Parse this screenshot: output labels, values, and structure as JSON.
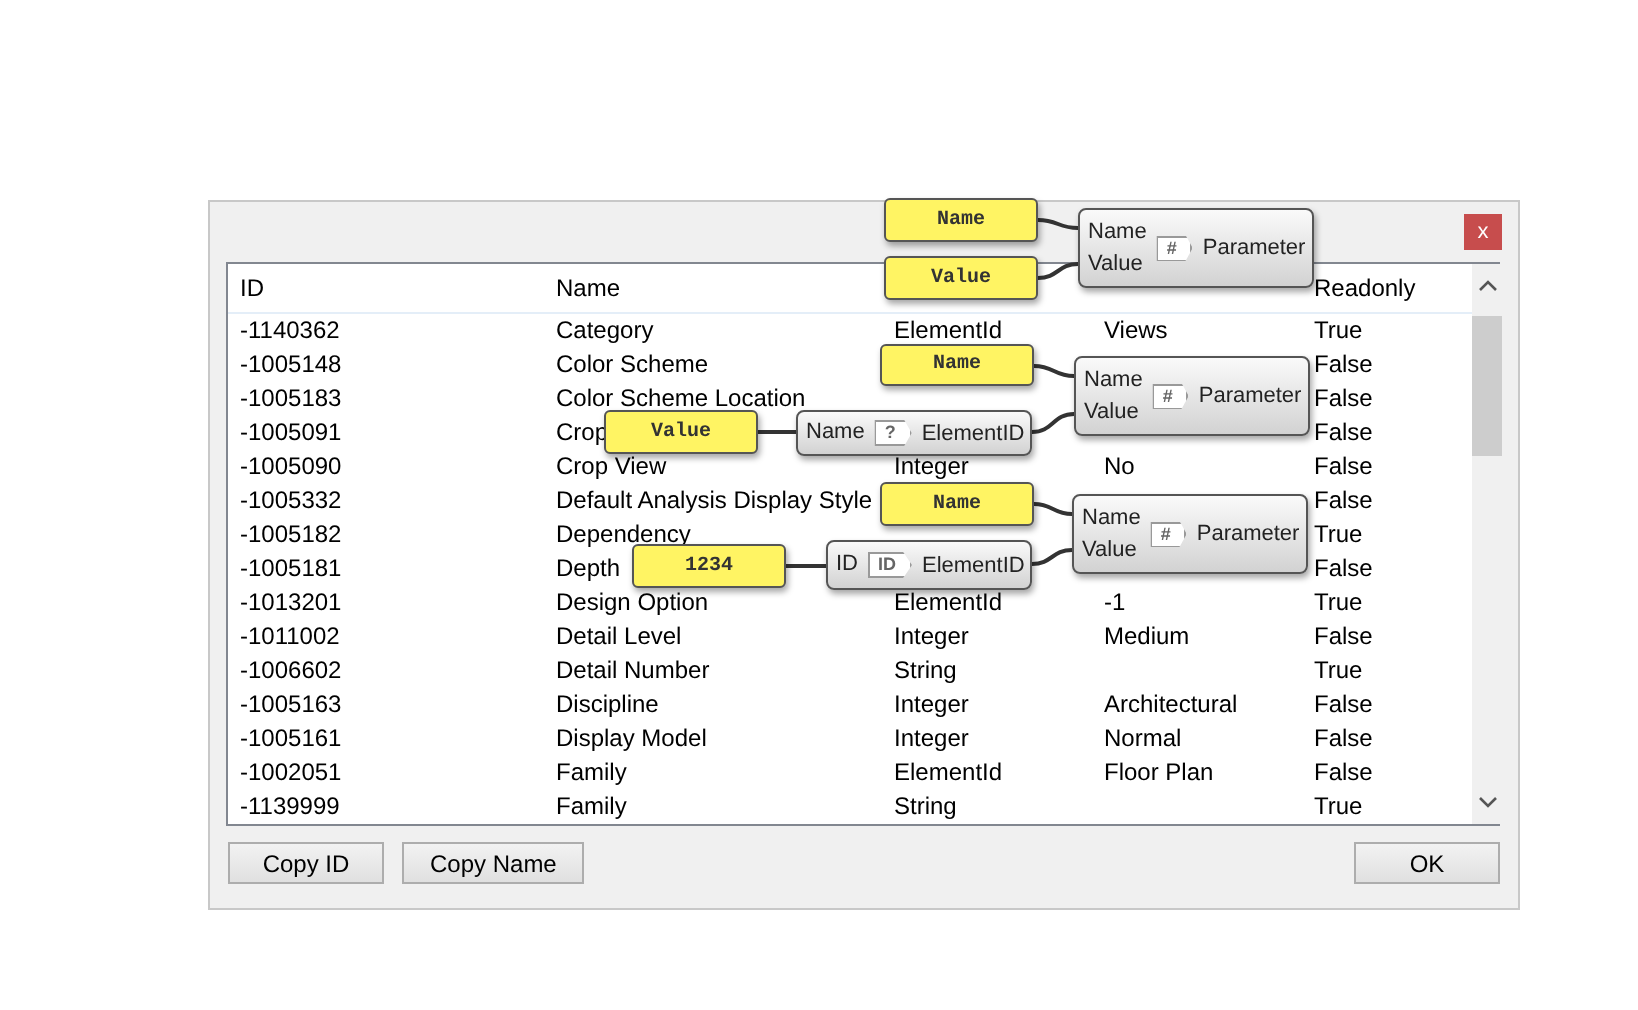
{
  "dialog": {
    "close_button": "x",
    "table": {
      "columns": [
        {
          "label": "ID"
        },
        {
          "label": "Name"
        },
        {},
        {},
        {
          "label": "Readonly"
        }
      ],
      "rows": [
        [
          "-1140362",
          "Category",
          "ElementId",
          "Views",
          "True"
        ],
        [
          "-1005148",
          "Color Scheme",
          null,
          null,
          "False"
        ],
        [
          "-1005183",
          "Color Scheme Location",
          null,
          null,
          "False"
        ],
        [
          "-1005091",
          "Crop",
          null,
          null,
          "False"
        ],
        [
          "-1005090",
          "Crop View",
          "Integer",
          "No",
          "False"
        ],
        [
          "-1005332",
          "Default Analysis Display Style",
          null,
          null,
          "False"
        ],
        [
          "-1005182",
          "Dependency",
          null,
          null,
          "True"
        ],
        [
          "-1005181",
          "Depth",
          null,
          null,
          "False"
        ],
        [
          "-1013201",
          "Design Option",
          "ElementId",
          "-1",
          "True"
        ],
        [
          "-1011002",
          "Detail Level",
          "Integer",
          "Medium",
          "False"
        ],
        [
          "-1006602",
          "Detail Number",
          "String",
          null,
          "True"
        ],
        [
          "-1005163",
          "Discipline",
          "Integer",
          "Architectural",
          "False"
        ],
        [
          "-1005161",
          "Display Model",
          "Integer",
          "Normal",
          "False"
        ],
        [
          "-1002051",
          "Family",
          "ElementId",
          "Floor Plan",
          "False"
        ],
        [
          "-1139999",
          "Family",
          "String",
          null,
          "True"
        ]
      ]
    },
    "buttons": [
      {
        "label": "Copy ID"
      },
      {
        "label": "Copy Name"
      },
      {
        "label": "OK"
      }
    ]
  },
  "canvas": {
    "panels": [
      {
        "text": "Name"
      },
      {
        "text": "Value"
      },
      {
        "text": "Name"
      },
      {
        "text": "Value"
      },
      {
        "text": "Name"
      },
      {
        "text": "1234"
      }
    ],
    "components": [
      {
        "inputs": [
          "Name",
          "Value"
        ],
        "tag": "#",
        "title": "Parameter"
      },
      {
        "inputs": [
          "Name",
          "Value"
        ],
        "tag": "#",
        "title": "Parameter"
      },
      {
        "inputs": [
          "Name",
          "Value"
        ],
        "tag": "#",
        "title": "Parameter"
      },
      {
        "inputs": [
          "Name"
        ],
        "tag": "?",
        "title": "ElementID"
      },
      {
        "inputs": [
          "ID"
        ],
        "tag": "ID",
        "title": "ElementID"
      }
    ]
  }
}
